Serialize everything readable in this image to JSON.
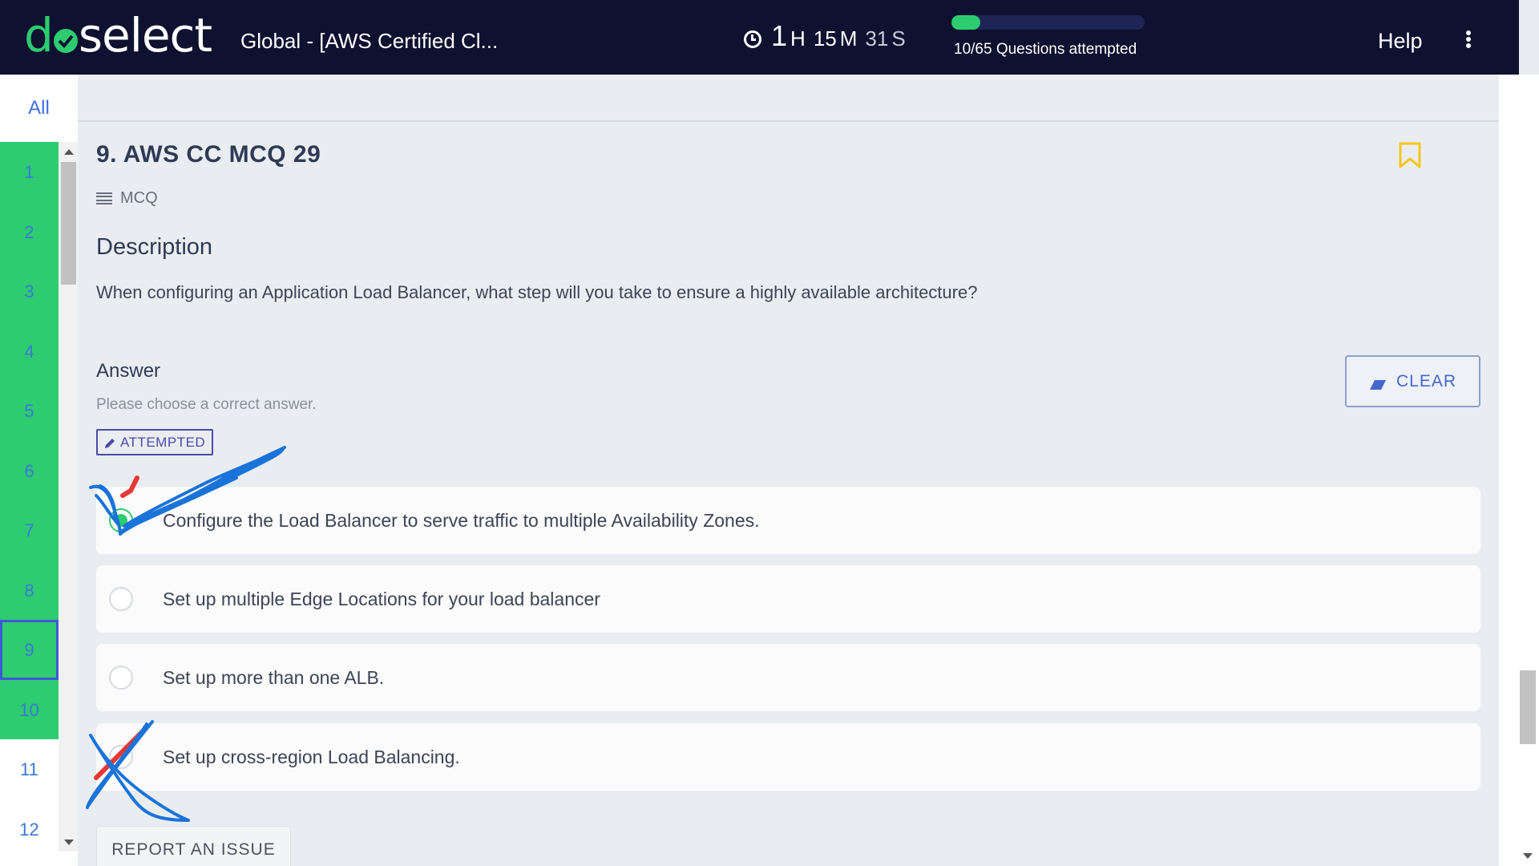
{
  "header": {
    "logo": {
      "part1": "d",
      "part2": "select"
    },
    "title": "Global - [AWS Certified Cl...",
    "timer": {
      "hours": "1",
      "h_unit": "H",
      "minutes": "15",
      "m_unit": "M",
      "seconds": "31",
      "s_unit": "S"
    },
    "progress": {
      "attempted": 10,
      "total": 65,
      "fraction": 0.15,
      "label": "10/65 Questions attempted"
    },
    "help_label": "Help"
  },
  "nav": {
    "all_label": "All",
    "questions": [
      {
        "num": "1",
        "state": "done"
      },
      {
        "num": "2",
        "state": "done"
      },
      {
        "num": "3",
        "state": "done"
      },
      {
        "num": "4",
        "state": "done"
      },
      {
        "num": "5",
        "state": "done"
      },
      {
        "num": "6",
        "state": "done"
      },
      {
        "num": "7",
        "state": "done"
      },
      {
        "num": "8",
        "state": "done"
      },
      {
        "num": "9",
        "state": "current"
      },
      {
        "num": "10",
        "state": "done"
      },
      {
        "num": "11",
        "state": "plain"
      },
      {
        "num": "12",
        "state": "plain"
      }
    ]
  },
  "question": {
    "title": "9. AWS CC MCQ 29",
    "type": "MCQ",
    "description_heading": "Description",
    "description": "When configuring an Application Load Balancer, what step will you take to ensure a highly available architecture?",
    "answer_heading": "Answer",
    "answer_hint": "Please choose a correct answer.",
    "status_badge": "ATTEMPTED",
    "clear_label": "CLEAR",
    "options": [
      {
        "text": "Configure the Load Balancer to serve traffic to multiple Availability Zones.",
        "selected": true
      },
      {
        "text": "Set up multiple Edge Locations for your load balancer",
        "selected": false
      },
      {
        "text": "Set up more than one ALB.",
        "selected": false
      },
      {
        "text": "Set up cross-region Load Balancing.",
        "selected": false
      }
    ],
    "report_label": "REPORT AN ISSUE"
  },
  "colors": {
    "header_bg": "#0e1130",
    "accent_green": "#2ecb71",
    "link_blue": "#3f6fe0",
    "bookmark_yellow": "#f5c518",
    "annotation_blue": "#1a73d9",
    "annotation_red": "#e53935"
  },
  "icons": [
    "clock-icon",
    "kebab-menu-icon",
    "bookmark-icon",
    "list-icon",
    "eraser-icon",
    "pencil-icon"
  ]
}
